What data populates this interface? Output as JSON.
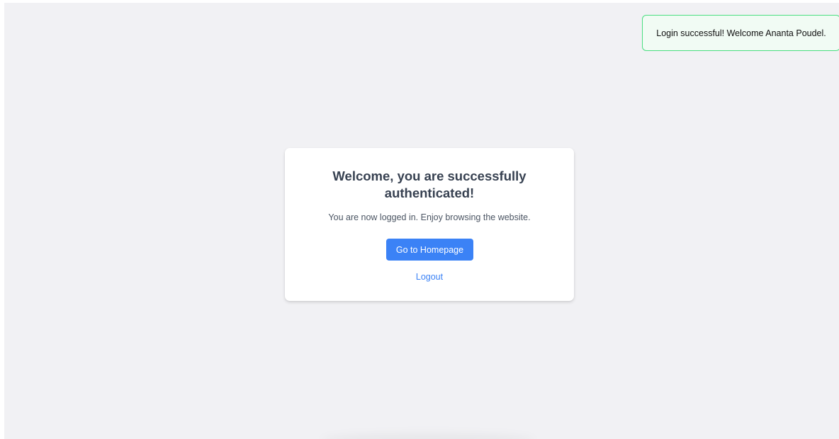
{
  "toast": {
    "message": "Login successful! Welcome Ananta Poudel.",
    "border_color": "#4ade80"
  },
  "card": {
    "title": "Welcome, you are successfully authenticated!",
    "message": "You are now logged in. Enjoy browsing the website.",
    "home_button_label": "Go to Homepage",
    "logout_label": "Logout"
  },
  "colors": {
    "background": "#f1f1f4",
    "accent": "#3b82f6",
    "heading": "#374151"
  }
}
